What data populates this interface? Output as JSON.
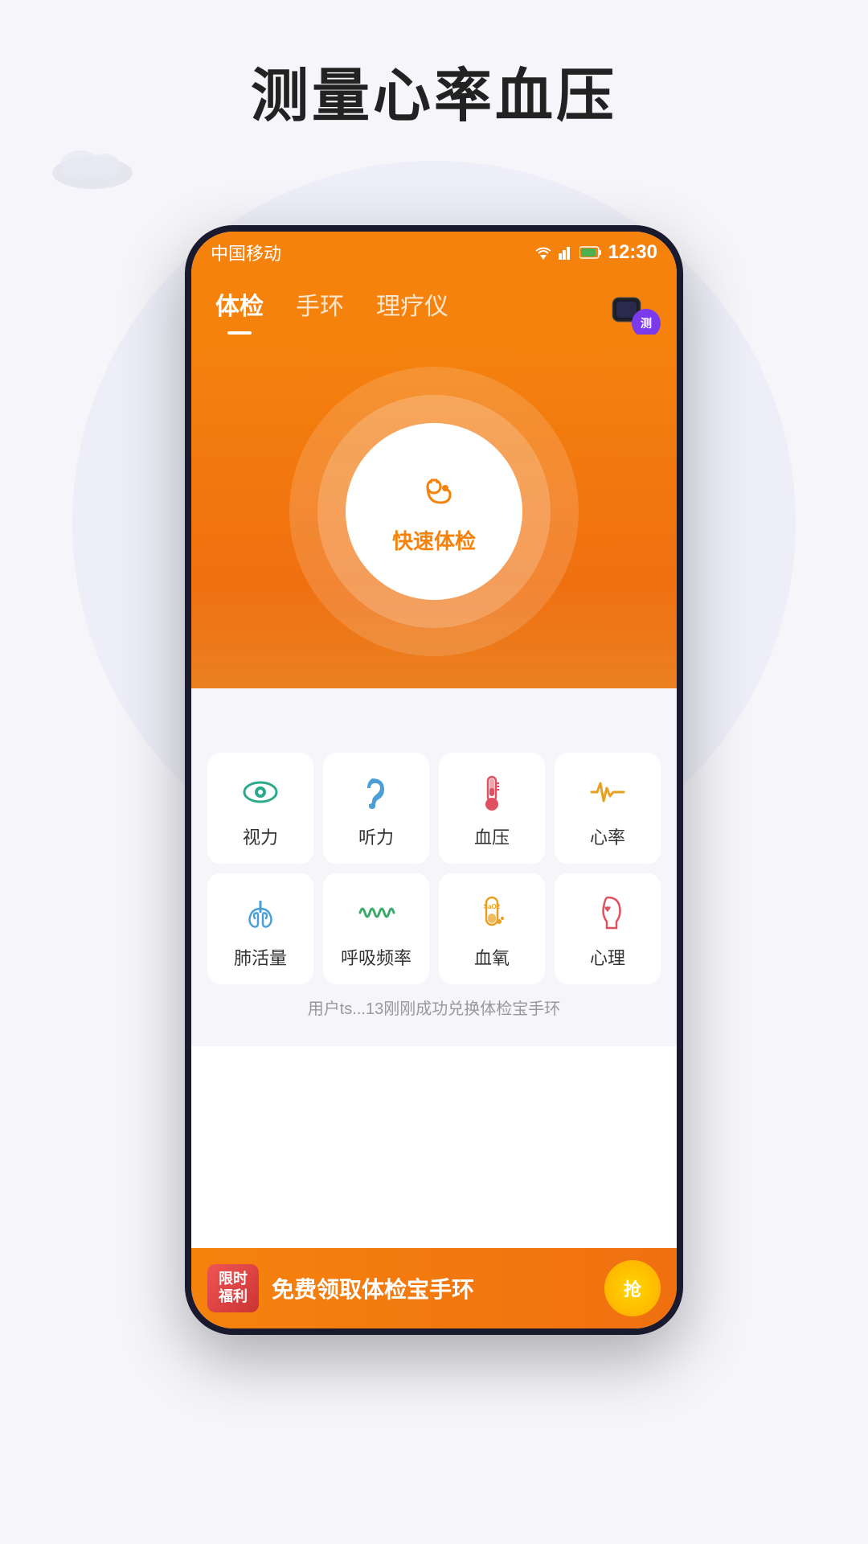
{
  "page": {
    "title": "测量心率血压",
    "background_color": "#f5f5fa"
  },
  "status_bar": {
    "carrier": "中国移动",
    "time": "12:30"
  },
  "tabs": [
    {
      "label": "体检",
      "active": true
    },
    {
      "label": "手环",
      "active": false
    },
    {
      "label": "理疗仪",
      "active": false
    }
  ],
  "hero": {
    "button_label": "快速体检",
    "device_badge": "测"
  },
  "health_items_row1": [
    {
      "id": "vision",
      "label": "视力",
      "icon": "👁",
      "color": "#2aaa8a"
    },
    {
      "id": "hearing",
      "label": "听力",
      "icon": "👂",
      "color": "#4a9fd4"
    },
    {
      "id": "blood_pressure",
      "label": "血压",
      "icon": "🌡",
      "color": "#e05060"
    },
    {
      "id": "heart_rate",
      "label": "心率",
      "icon": "📈",
      "color": "#e8a020"
    }
  ],
  "health_items_row2": [
    {
      "id": "lung_capacity",
      "label": "肺活量",
      "icon": "🫁",
      "color": "#4a9fd4"
    },
    {
      "id": "breath_rate",
      "label": "呼吸频率",
      "icon": "〰",
      "color": "#3aaa6a"
    },
    {
      "id": "blood_oxygen",
      "label": "血氧",
      "icon": "🧪",
      "color": "#e8a020"
    },
    {
      "id": "psychology",
      "label": "心理",
      "icon": "🧠",
      "color": "#e05060"
    }
  ],
  "notification": {
    "text": "用户ts...13刚刚成功兑换体检宝手环"
  },
  "banner": {
    "badge_line1": "限时",
    "badge_line2": "福利",
    "text": "免费领取体检宝手环",
    "button": "抢"
  }
}
